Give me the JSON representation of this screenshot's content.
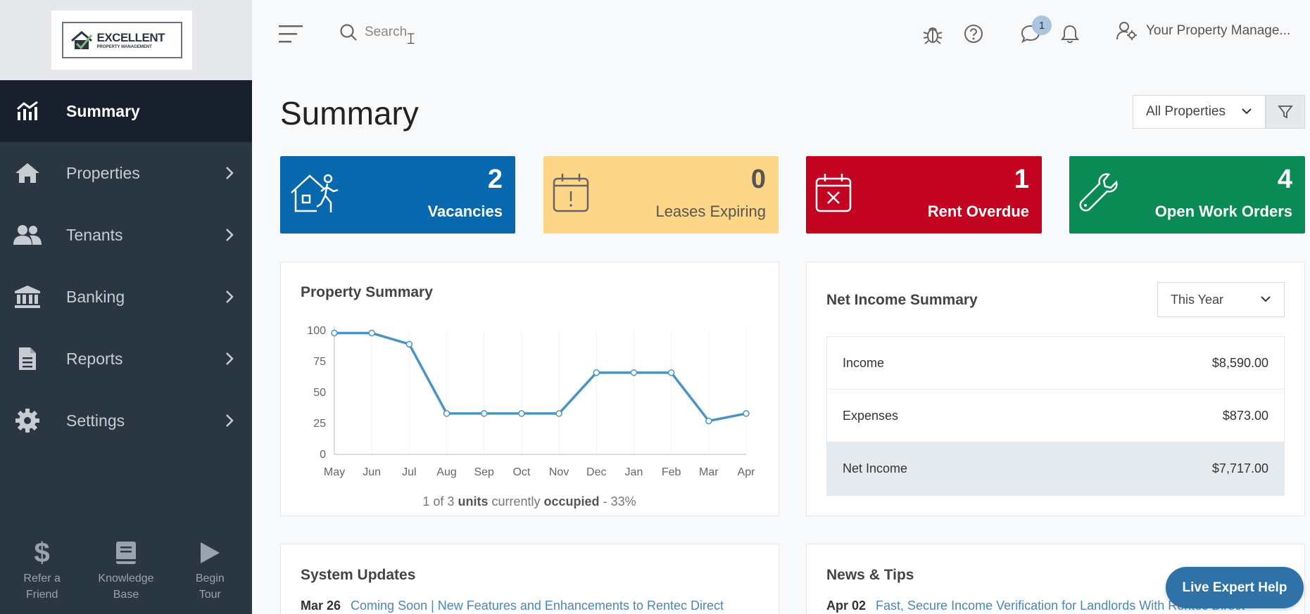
{
  "logo": {
    "line1": "EXCELLENT",
    "line2": "PROPERTY MANAGEMENT"
  },
  "sidebar": {
    "items": [
      {
        "label": "Summary",
        "icon": "chart-icon",
        "active": true
      },
      {
        "label": "Properties",
        "icon": "home-icon"
      },
      {
        "label": "Tenants",
        "icon": "users-icon"
      },
      {
        "label": "Banking",
        "icon": "bank-icon"
      },
      {
        "label": "Reports",
        "icon": "document-icon"
      },
      {
        "label": "Settings",
        "icon": "gear-icon"
      }
    ],
    "bottom": [
      {
        "line1": "Refer a",
        "line2": "Friend",
        "icon": "dollar-icon"
      },
      {
        "line1": "Knowledge",
        "line2": "Base",
        "icon": "book-icon"
      },
      {
        "line1": "Begin",
        "line2": "Tour",
        "icon": "play-icon"
      }
    ]
  },
  "topbar": {
    "search_placeholder": "Search",
    "chat_badge": "1",
    "user_label": "Your Property Manage..."
  },
  "page": {
    "title": "Summary",
    "property_filter": "All Properties"
  },
  "cards": {
    "vacancies": {
      "num": "2",
      "label": "Vacancies",
      "color": "#0868ae"
    },
    "leases": {
      "num": "0",
      "label": "Leases Expiring",
      "color": "#fdd688"
    },
    "overdue": {
      "num": "1",
      "label": "Rent Overdue",
      "color": "#c30420"
    },
    "work": {
      "num": "4",
      "label": "Open Work Orders",
      "color": "#0a8a55"
    }
  },
  "property_summary": {
    "title": "Property Summary",
    "occupancy": {
      "a": "1 of 3",
      "b": "units",
      "c": "currently",
      "d": "occupied",
      "e": "- 33%"
    }
  },
  "chart_data": {
    "type": "line",
    "categories": [
      "May",
      "Jun",
      "Jul",
      "Aug",
      "Sep",
      "Oct",
      "Nov",
      "Dec",
      "Jan",
      "Feb",
      "Mar",
      "Apr"
    ],
    "values": [
      98,
      98,
      89,
      33,
      33,
      33,
      33,
      66,
      66,
      66,
      27,
      33
    ],
    "yticks": [
      "100",
      "75",
      "50",
      "25",
      "0"
    ],
    "ylim": [
      0,
      100
    ],
    "grid": true,
    "color": "#4a93c6"
  },
  "net_income": {
    "title": "Net Income Summary",
    "period": "This Year",
    "rows": [
      {
        "label": "Income",
        "value": "$8,590.00"
      },
      {
        "label": "Expenses",
        "value": "$873.00"
      },
      {
        "label": "Net Income",
        "value": "$7,717.00"
      }
    ]
  },
  "system_updates": {
    "title": "System Updates",
    "date": "Mar 26",
    "text": "Coming Soon | New Features and Enhancements to Rentec Direct"
  },
  "news": {
    "title": "News & Tips",
    "date": "Apr 02",
    "text": "Fast, Secure Income Verification for Landlords With Rentec Direct"
  },
  "live_help": "Live Expert Help"
}
